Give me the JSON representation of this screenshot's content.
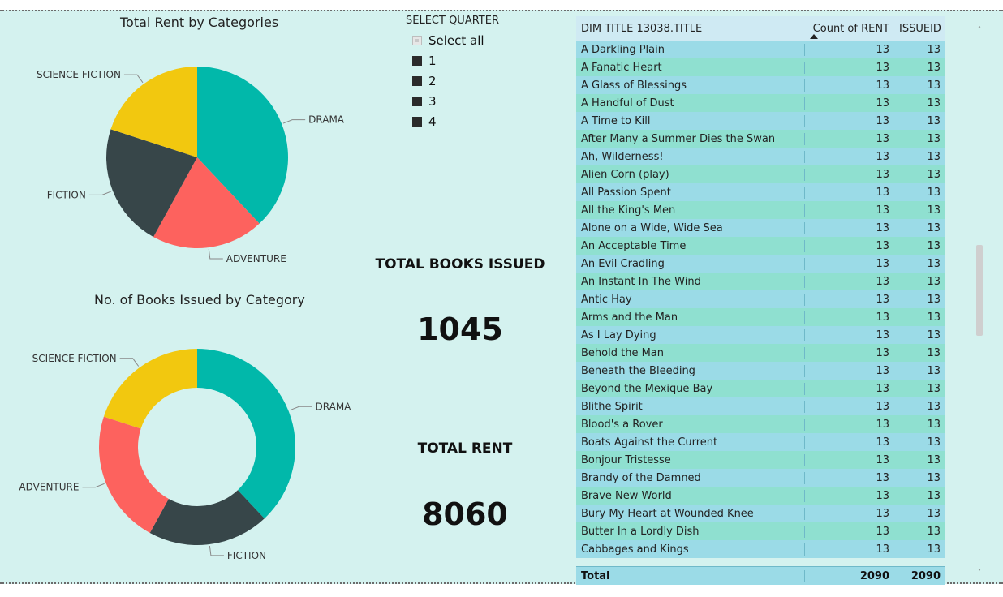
{
  "colors": {
    "drama": "#01b8aa",
    "adventure": "#fd625e",
    "fiction": "#374649",
    "science_fiction": "#f2c80f"
  },
  "rent_chart": {
    "title": "Total Rent by Categories",
    "chart_data": {
      "type": "pie",
      "categories": [
        "DRAMA",
        "ADVENTURE",
        "FICTION",
        "SCIENCE FICTION"
      ],
      "values": [
        38,
        20,
        22,
        20
      ]
    }
  },
  "issued_chart": {
    "title": "No. of Books Issued by Category",
    "chart_data": {
      "type": "pie",
      "categories": [
        "DRAMA",
        "FICTION",
        "ADVENTURE",
        "SCIENCE FICTION"
      ],
      "values": [
        38,
        20,
        22,
        20
      ]
    }
  },
  "slicer": {
    "title": "SELECT QUARTER",
    "items": [
      {
        "label": "Select all",
        "state": "partial"
      },
      {
        "label": "1",
        "state": "on"
      },
      {
        "label": "2",
        "state": "on"
      },
      {
        "label": "3",
        "state": "on"
      },
      {
        "label": "4",
        "state": "on"
      }
    ]
  },
  "cards": {
    "books_label": "TOTAL BOOKS ISSUED",
    "books_value": "1045",
    "rent_label": "TOTAL RENT",
    "rent_value": "8060"
  },
  "table": {
    "headers": [
      "DIM TITLE 13038.TITLE",
      "Count of RENT",
      "ISSUEID"
    ],
    "rows": [
      [
        "A Darkling Plain",
        "13",
        "13"
      ],
      [
        "A Fanatic Heart",
        "13",
        "13"
      ],
      [
        "A Glass of Blessings",
        "13",
        "13"
      ],
      [
        "A Handful of Dust",
        "13",
        "13"
      ],
      [
        "A Time to Kill",
        "13",
        "13"
      ],
      [
        "After Many a Summer Dies the Swan",
        "13",
        "13"
      ],
      [
        "Ah, Wilderness!",
        "13",
        "13"
      ],
      [
        "Alien Corn (play)",
        "13",
        "13"
      ],
      [
        "All Passion Spent",
        "13",
        "13"
      ],
      [
        "All the King's Men",
        "13",
        "13"
      ],
      [
        "Alone on a Wide, Wide Sea",
        "13",
        "13"
      ],
      [
        "An Acceptable Time",
        "13",
        "13"
      ],
      [
        "An Evil Cradling",
        "13",
        "13"
      ],
      [
        "An Instant In The Wind",
        "13",
        "13"
      ],
      [
        "Antic Hay",
        "13",
        "13"
      ],
      [
        "Arms and the Man",
        "13",
        "13"
      ],
      [
        "As I Lay Dying",
        "13",
        "13"
      ],
      [
        "Behold the Man",
        "13",
        "13"
      ],
      [
        "Beneath the Bleeding",
        "13",
        "13"
      ],
      [
        "Beyond the Mexique Bay",
        "13",
        "13"
      ],
      [
        "Blithe Spirit",
        "13",
        "13"
      ],
      [
        "Blood's a Rover",
        "13",
        "13"
      ],
      [
        "Boats Against the Current",
        "13",
        "13"
      ],
      [
        "Bonjour Tristesse",
        "13",
        "13"
      ],
      [
        "Brandy of the Damned",
        "13",
        "13"
      ],
      [
        "Brave New World",
        "13",
        "13"
      ],
      [
        "Bury My Heart at Wounded Knee",
        "13",
        "13"
      ],
      [
        "Butter In a Lordly Dish",
        "13",
        "13"
      ],
      [
        "Cabbages and Kings",
        "13",
        "13"
      ]
    ],
    "total": [
      "Total",
      "2090",
      "2090"
    ]
  },
  "scrollbar": {
    "position": 0.48
  }
}
